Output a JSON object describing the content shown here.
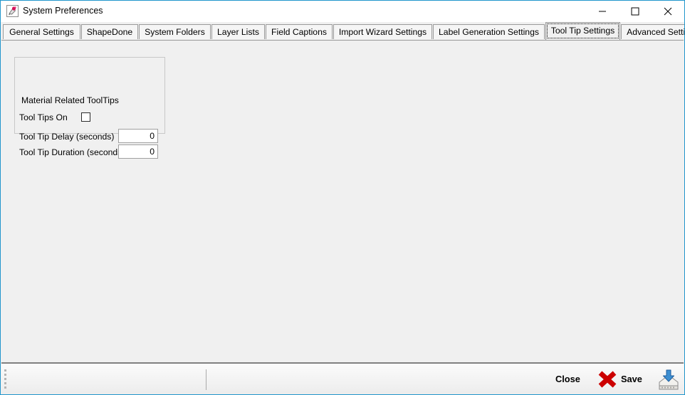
{
  "window": {
    "title": "System Preferences",
    "icon": "application-icon",
    "accent_border_color": "#2196cc",
    "controls": {
      "minimize": "Minimize",
      "maximize": "Maximize",
      "close": "Close"
    }
  },
  "tabs": [
    {
      "label": "General Settings",
      "selected": false
    },
    {
      "label": "ShapeDone",
      "selected": false
    },
    {
      "label": "System Folders",
      "selected": false
    },
    {
      "label": "Layer Lists",
      "selected": false
    },
    {
      "label": "Field Captions",
      "selected": false
    },
    {
      "label": "Import Wizard Settings",
      "selected": false
    },
    {
      "label": "Label Generation Settings",
      "selected": false
    },
    {
      "label": "Tool Tip Settings",
      "selected": true
    },
    {
      "label": "Advanced Settings",
      "selected": false
    }
  ],
  "panel": {
    "groupbox": {
      "legend": "Material Related ToolTips",
      "tooltips_on": {
        "label": "Tool Tips On",
        "checked": false
      },
      "delay": {
        "label": "Tool Tip Delay (seconds)",
        "value": "0",
        "placeholder": ""
      },
      "duration": {
        "label": "Tool Tip Duration (seconds)",
        "value": "0",
        "placeholder": ""
      }
    }
  },
  "statusbar": {
    "grip": "resize-grip",
    "close": {
      "label": "Close",
      "icon": "red-x-icon",
      "icon_color": "#cc0000"
    },
    "save": {
      "label": "Save",
      "icon": "save-disk-icon",
      "icon_color": "#2b6fb5"
    }
  }
}
